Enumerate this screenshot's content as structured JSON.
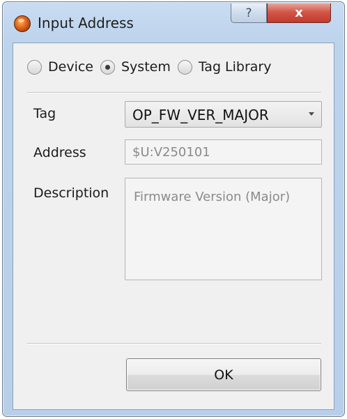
{
  "window": {
    "title": "Input Address",
    "help_label": "?",
    "close_label": "x"
  },
  "source": {
    "options": [
      {
        "label": "Device",
        "checked": false
      },
      {
        "label": "System",
        "checked": true
      },
      {
        "label": "Tag Library",
        "checked": false
      }
    ]
  },
  "form": {
    "tag_label": "Tag",
    "tag_value": "OP_FW_VER_MAJOR",
    "address_label": "Address",
    "address_value": "$U:V250101",
    "description_label": "Description",
    "description_value": "Firmware Version (Major)"
  },
  "actions": {
    "ok_label": "OK"
  },
  "colors": {
    "frame": "#bcd3ec",
    "client": "#f0f0f0",
    "close": "#c2392c"
  }
}
